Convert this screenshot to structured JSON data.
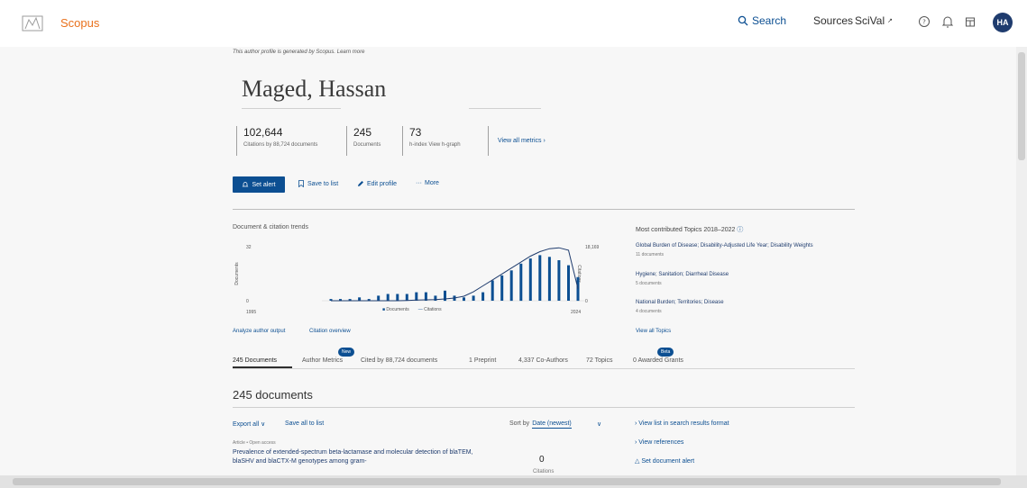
{
  "app": {
    "brand": "Scopus"
  },
  "nav": {
    "search": "Search",
    "sources": "Sources",
    "scival": "SciVal",
    "avatar_initials": "HA"
  },
  "profile": {
    "notice": "This author profile is generated by Scopus. Learn more",
    "name": "Maged, Hassan",
    "metrics": [
      {
        "value": "102,644",
        "label": "Citations by 88,724 documents"
      },
      {
        "value": "245",
        "label": "Documents"
      },
      {
        "value": "73",
        "label": "h-index View h-graph"
      }
    ],
    "view_all_metrics": "View all metrics ›"
  },
  "actions": {
    "set_alert": "Set alert",
    "save_to_list": "Save to list",
    "edit_profile": "Edit profile",
    "more": "More"
  },
  "chart_data": {
    "type": "bar",
    "title": "Document & citation trends",
    "ylabel": "Documents",
    "y2label": "Citations",
    "x_start": "1995",
    "x_end": "2024",
    "ylim": [
      0,
      32
    ],
    "y2lim": [
      0,
      18169
    ],
    "y_ticks": [
      "32",
      "0"
    ],
    "y2_ticks": [
      "18,169",
      "0"
    ],
    "series": [
      {
        "name": "Documents",
        "values": [
          1,
          1,
          1,
          2,
          1,
          3,
          4,
          4,
          4,
          5,
          5,
          3,
          6,
          3,
          2,
          3,
          5,
          12,
          15,
          18,
          22,
          25,
          27,
          26,
          24,
          21,
          14
        ]
      },
      {
        "name": "Citations",
        "values": [
          0,
          0,
          0,
          0,
          0,
          0,
          0,
          0,
          100,
          200,
          300,
          400,
          600,
          900,
          1500,
          3000,
          5000,
          7000,
          9000,
          11000,
          13000,
          15000,
          16500,
          17500,
          17800,
          17000,
          4000
        ]
      }
    ],
    "legend": [
      "Documents",
      "Citations"
    ],
    "links": [
      "Analyze author output",
      "Citation overview"
    ]
  },
  "topics": {
    "title": "Most contributed Topics 2018–2022",
    "items": [
      {
        "name": "Global Burden of Disease; Disability-Adjusted Life Year; Disability Weights",
        "count": "11 documents"
      },
      {
        "name": "Hygiene; Sanitation; Diarrheal Disease",
        "count": "5 documents"
      },
      {
        "name": "National Burden; Territories; Disease",
        "count": "4 documents"
      }
    ],
    "view_all": "View all Topics"
  },
  "tabs": [
    {
      "label": "245 Documents"
    },
    {
      "label": "Author Metrics"
    },
    {
      "label": "Cited by 88,724 documents"
    },
    {
      "label": "1 Preprint"
    },
    {
      "label": "4,337 Co-Authors"
    },
    {
      "label": "72 Topics"
    },
    {
      "label": "0 Awarded Grants"
    }
  ],
  "badges": {
    "new": "New",
    "beta": "Beta"
  },
  "documents": {
    "heading": "245 documents",
    "export_all": "Export all ∨",
    "save_all": "Save all to list",
    "sort_by": "Sort by",
    "sort_value": "Date (newest)",
    "right_links": [
      "View list in search results format",
      "View references",
      "Set document alert"
    ],
    "first": {
      "type": "Article • Open access",
      "title": "Prevalence of extended-spectrum beta-lactamase and molecular detection of blaTEM, blaSHV and blaCTX-M genotypes among gram-",
      "citations": "0",
      "citations_label": "Citations"
    }
  },
  "colors": {
    "accent": "#0c4f92",
    "brand": "#e9711c",
    "avatar": "#1f3c6e"
  }
}
